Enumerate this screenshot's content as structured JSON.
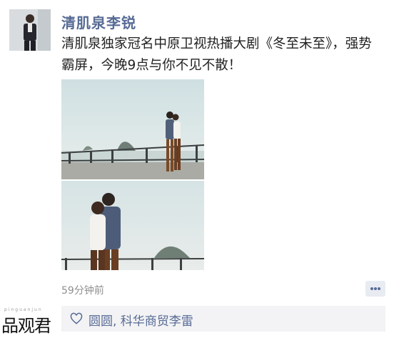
{
  "post": {
    "author": "清肌泉李锐",
    "text": "清肌泉独家冠名中原卫视热播大剧《冬至未至》，强势霸屏，今晚9点与你不见不散！",
    "time": "59分钟前",
    "likes": "圆圆, 科华商贸李雷"
  },
  "icons": {
    "avatar": "profile-photo",
    "comment": "comment-dots-icon",
    "like": "heart-icon"
  },
  "watermark": {
    "main": "品观君",
    "small": "pinguanjun"
  },
  "colors": {
    "link": "#576b95",
    "likes_bg": "#f3f3f5",
    "time": "#8f8f8f"
  }
}
